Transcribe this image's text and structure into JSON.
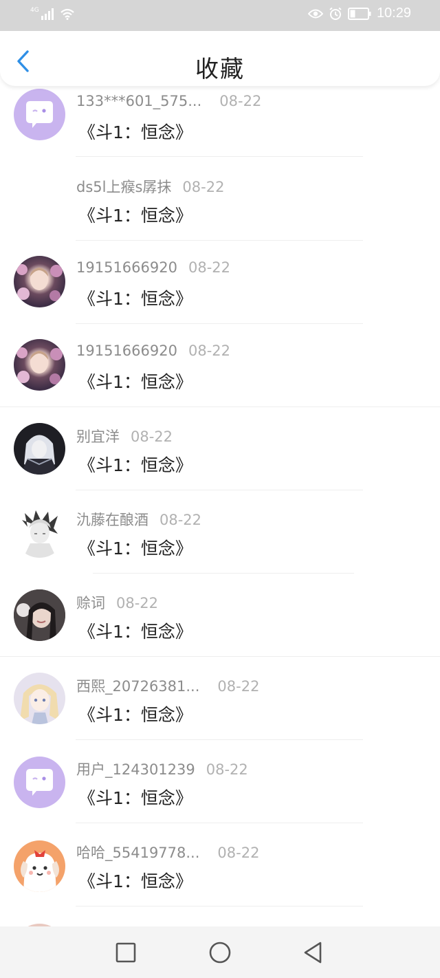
{
  "status_bar": {
    "network": "4G",
    "time": "10:29",
    "icons": [
      "signal-icon",
      "wifi-icon",
      "eye-icon",
      "alarm-icon",
      "battery-icon"
    ]
  },
  "header": {
    "title": "收藏",
    "back_icon": "chevron-left-icon"
  },
  "items": [
    {
      "name": "133***601_575...",
      "date": "08-22",
      "content": "《斗1：恒念》",
      "avatar": "default-chat-avatar"
    },
    {
      "name": "ds5l上瘊s孱抹",
      "date": "08-22",
      "content": "《斗1：恒念》",
      "avatar": "none"
    },
    {
      "name": "19151666920",
      "date": "08-22",
      "content": "《斗1：恒念》",
      "avatar": "photo-flowers"
    },
    {
      "name": "19151666920",
      "date": "08-22",
      "content": "《斗1：恒念》",
      "avatar": "photo-flowers"
    },
    {
      "name": "别宜洋",
      "date": "08-22",
      "content": "《斗1：恒念》",
      "avatar": "photo-dark-anime"
    },
    {
      "name": "氿藤在酿酒",
      "date": "08-22",
      "content": "《斗1：恒念》",
      "avatar": "photo-white-anime"
    },
    {
      "name": "赊词",
      "date": "08-22",
      "content": "《斗1：恒念》",
      "avatar": "photo-girl-headphones"
    },
    {
      "name": "西熙_20726381...",
      "date": "08-22",
      "content": "《斗1：恒念》",
      "avatar": "photo-blonde-anime"
    },
    {
      "name": "用户_124301239",
      "date": "08-22",
      "content": "《斗1：恒念》",
      "avatar": "default-chat-avatar"
    },
    {
      "name": "哈哈_55419778...",
      "date": "08-22",
      "content": "《斗1：恒念》",
      "avatar": "cartoon-dog"
    }
  ],
  "nav_bar": {
    "buttons": [
      "recents-square-icon",
      "home-circle-icon",
      "back-triangle-icon"
    ]
  },
  "colors": {
    "accent": "#2f8fe6",
    "default_avatar_bg": "#c9b4ef",
    "status_bar_bg": "#d6d6d6",
    "nav_bar_bg": "#f4f4f4"
  }
}
